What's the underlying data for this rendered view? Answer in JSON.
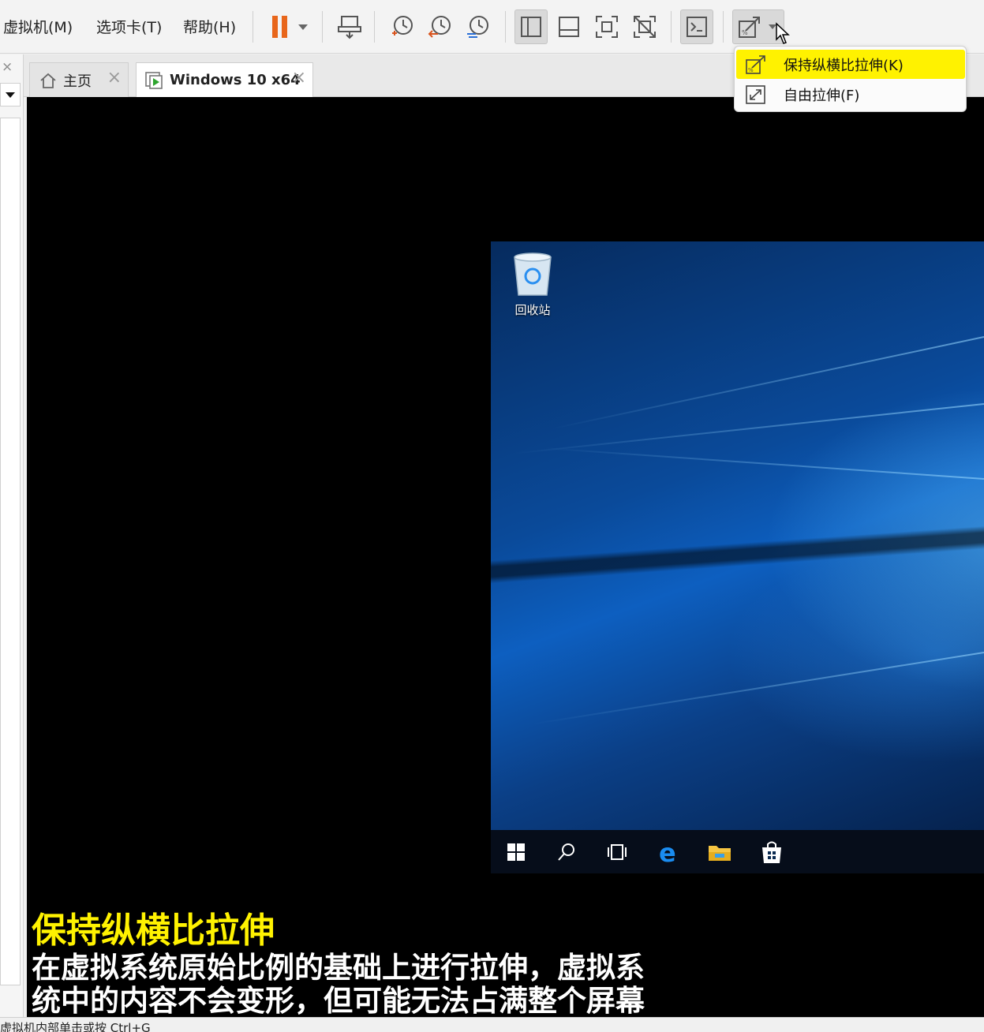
{
  "menubar": {
    "vm": "虚拟机(M)",
    "tabs": "选项卡(T)",
    "help": "帮助(H)"
  },
  "toolbar": {
    "icons": [
      "pause-icon",
      "send-keys-icon",
      "snapshot-icon",
      "revert-snapshot-icon",
      "snapshot-manager-icon",
      "show-library-icon",
      "thumbnail-bar-icon",
      "fullscreen-icon",
      "unity-icon",
      "console-icon",
      "stretch-icon"
    ],
    "pause_color": "#e8661b"
  },
  "tabs": [
    {
      "label": "主页"
    },
    {
      "label": "Windows 10 x64"
    }
  ],
  "stretch_menu": {
    "keep_ratio": "保持纵横比拉伸(K)",
    "free": "自由拉伸(F)",
    "highlight_color": "#fff200"
  },
  "guest": {
    "recycle_bin": "回收站"
  },
  "subtitle": {
    "title": "保持纵横比拉伸",
    "line1": "在虚拟系统原始比例的基础上进行拉伸，虚拟系",
    "line2": "统中的内容不会变形，但可能无法占满整个屏幕",
    "title_color": "#fff200"
  },
  "status": {
    "text": "虚拟机内部单击或按 Ctrl+G"
  }
}
